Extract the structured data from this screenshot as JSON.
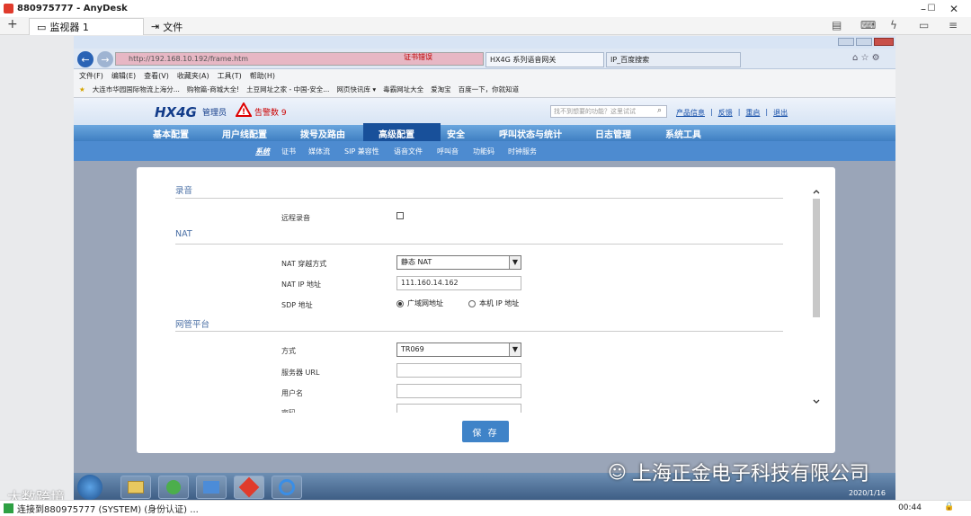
{
  "anydesk": {
    "title": "880975777 - AnyDesk",
    "tabs": [
      "监视器 1",
      "文件"
    ],
    "status": "连接到880975777 (SYSTEM) (身份认证) ...",
    "clock": "00:44"
  },
  "browser": {
    "address": "http://192.168.10.192/frame.htm",
    "address_extra": "证书错误",
    "tabs": [
      "HX4G 系列语音网关",
      "IP_百度搜索"
    ],
    "menu": [
      "文件(F)",
      "编辑(E)",
      "查看(V)",
      "收藏夹(A)",
      "工具(T)",
      "帮助(H)"
    ],
    "favorites": [
      "大连市华园国际物流上海分...",
      "购物篇-商城大全!",
      "土豆网址之家 - 中国-安全...",
      "网页快讯库 ▾",
      "毒霸网址大全",
      "爱淘宝",
      "百度一下，你就知道"
    ]
  },
  "header": {
    "brand": "HX4G",
    "role": "管理员",
    "alarm": "告警数 9",
    "search_placeholder": "找不到想要的功能？这里试试",
    "links": [
      "产品信息",
      "反馈",
      "重启",
      "退出"
    ]
  },
  "nav": {
    "main": [
      "基本配置",
      "用户线配置",
      "拨号及路由",
      "高级配置",
      "安全",
      "呼叫状态与统计",
      "日志管理",
      "系统工具"
    ],
    "active": "高级配置",
    "sub": [
      "系统",
      "证书",
      "媒体流",
      "SIP 兼容性",
      "语音文件",
      "呼叫音",
      "功能码",
      "时钟服务"
    ]
  },
  "form": {
    "record_section": "录音",
    "remote_record_label": "远程录音",
    "nat_section": "NAT",
    "nat_mode_label": "NAT 穿越方式",
    "nat_mode_value": "静态 NAT",
    "nat_ip_label": "NAT IP 地址",
    "nat_ip_value": "111.160.14.162",
    "sdp_label": "SDP 地址",
    "sdp_opt1": "广域网地址",
    "sdp_opt2": "本机 IP 地址",
    "mgmt_section": "网管平台",
    "method_label": "方式",
    "method_value": "TR069",
    "server_url_label": "服务器 URL",
    "username_label": "用户名",
    "password_label": "密码",
    "save_label": "保 存"
  },
  "taskbar": {
    "date": "2020/1/16"
  },
  "watermarks": [
    "上海正金电子科技有限公司",
    "大数跨境"
  ],
  "colors": {
    "nav_blue": "#4d8bd0",
    "nav_active": "#18509a",
    "alarm_red": "#cc0000"
  }
}
